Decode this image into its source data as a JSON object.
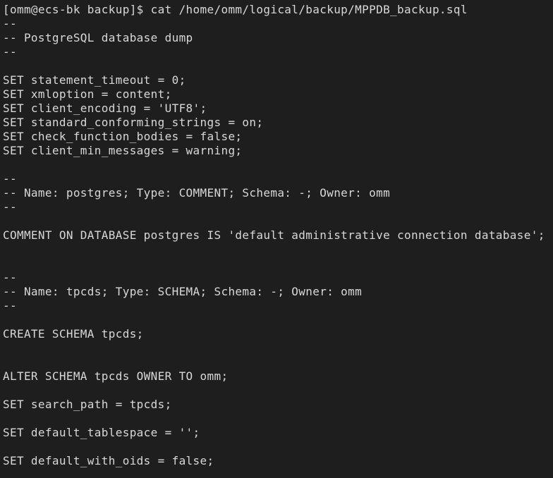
{
  "terminal": {
    "colors": {
      "background": "#1e1e1e",
      "foreground": "#d8d8d8"
    },
    "lines": [
      "[omm@ecs-bk backup]$ cat /home/omm/logical/backup/MPPDB_backup.sql",
      "--",
      "-- PostgreSQL database dump",
      "--",
      "",
      "SET statement_timeout = 0;",
      "SET xmloption = content;",
      "SET client_encoding = 'UTF8';",
      "SET standard_conforming_strings = on;",
      "SET check_function_bodies = false;",
      "SET client_min_messages = warning;",
      "",
      "--",
      "-- Name: postgres; Type: COMMENT; Schema: -; Owner: omm",
      "--",
      "",
      "COMMENT ON DATABASE postgres IS 'default administrative connection database';",
      "",
      "",
      "--",
      "-- Name: tpcds; Type: SCHEMA; Schema: -; Owner: omm",
      "--",
      "",
      "CREATE SCHEMA tpcds;",
      "",
      "",
      "ALTER SCHEMA tpcds OWNER TO omm;",
      "",
      "SET search_path = tpcds;",
      "",
      "SET default_tablespace = '';",
      "",
      "SET default_with_oids = false;"
    ]
  }
}
